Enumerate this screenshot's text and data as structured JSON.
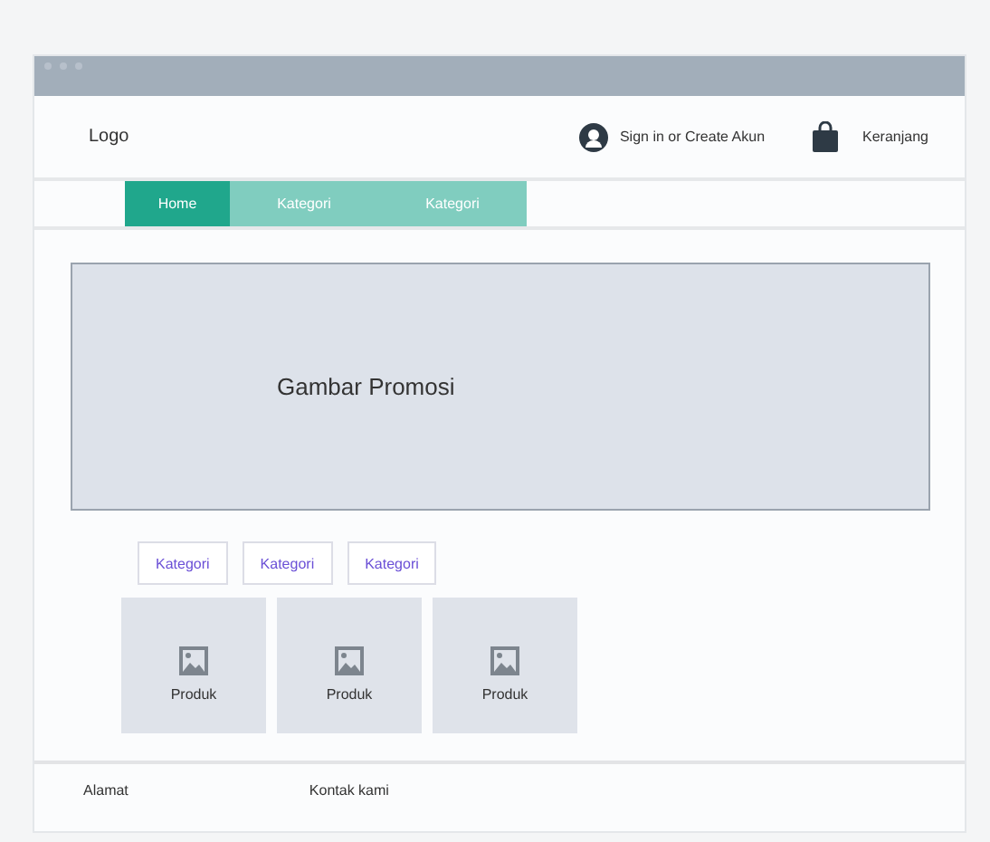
{
  "header": {
    "logo": "Logo",
    "account": "Sign in or Create Akun",
    "cart": "Keranjang"
  },
  "nav_tabs": [
    {
      "label": "Home",
      "selected": true
    },
    {
      "label": "Kategori",
      "selected": false
    },
    {
      "label": "Kategori",
      "selected": false
    }
  ],
  "banner": {
    "label": "Gambar Promosi"
  },
  "category_chips": [
    "Kategori",
    "Kategori",
    "Kategori"
  ],
  "products": [
    {
      "label": "Produk"
    },
    {
      "label": "Produk"
    },
    {
      "label": "Produk"
    }
  ],
  "footer": [
    "Alamat",
    "Kontak kami"
  ]
}
